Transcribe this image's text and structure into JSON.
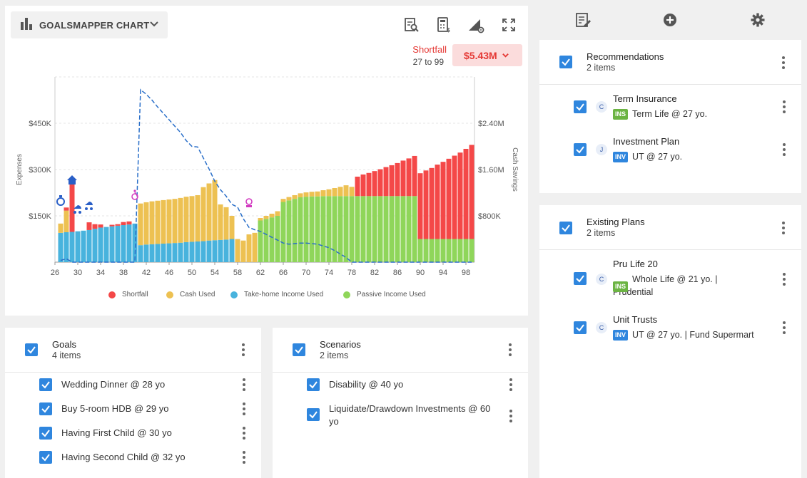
{
  "chart_panel": {
    "dropdown_label": "GOALSMAPPER CHART",
    "shortfall_label": "Shortfall",
    "shortfall_age": "27 to 99",
    "shortfall_value": "$5.43M"
  },
  "colors": {
    "shortfall": "#f44848",
    "cash": "#edc152",
    "takehome": "#48b3dd",
    "passive": "#8fd65a",
    "savings_line": "#2a6fc9",
    "accent": "#2f86de"
  },
  "chart_data": {
    "type": "bar",
    "stacked": true,
    "x_ticks": [
      "26",
      "30",
      "34",
      "38",
      "42",
      "46",
      "50",
      "54",
      "58",
      "62",
      "66",
      "70",
      "74",
      "78",
      "82",
      "86",
      "90",
      "94",
      "98"
    ],
    "ages": [
      27,
      28,
      29,
      30,
      31,
      32,
      33,
      34,
      35,
      36,
      37,
      38,
      39,
      40,
      41,
      42,
      43,
      44,
      45,
      46,
      47,
      48,
      49,
      50,
      51,
      52,
      53,
      54,
      55,
      56,
      57,
      58,
      59,
      60,
      61,
      62,
      63,
      64,
      65,
      66,
      67,
      68,
      69,
      70,
      71,
      72,
      73,
      74,
      75,
      76,
      77,
      78,
      79,
      80,
      81,
      82,
      83,
      84,
      85,
      86,
      87,
      88,
      89,
      90,
      91,
      92,
      93,
      94,
      95,
      96,
      97,
      98,
      99
    ],
    "y_left_label": "Expenses",
    "y_left_ticks": [
      "$150K",
      "$300K",
      "$450K"
    ],
    "y_right_label": "Cash Savings",
    "y_right_ticks": [
      "$800K",
      "$1.60M",
      "$2.40M"
    ],
    "y_left_range": [
      0,
      600000
    ],
    "y_right_range": [
      0,
      3200000
    ],
    "grid": true,
    "series": [
      {
        "name": "Take-home Income Used",
        "values": [
          95000,
          97000,
          98000,
          100000,
          102000,
          104000,
          108000,
          112000,
          114000,
          116000,
          118000,
          120000,
          122000,
          125000,
          55000,
          57000,
          58000,
          59000,
          60000,
          61000,
          62000,
          63000,
          65000,
          66000,
          67000,
          68000,
          70000,
          71000,
          72000,
          73000,
          75000,
          0,
          0,
          0,
          0,
          0,
          0,
          0,
          0,
          0,
          0,
          0,
          0,
          0,
          0,
          0,
          0,
          0,
          0,
          0,
          0,
          0,
          0,
          0,
          0,
          0,
          0,
          0,
          0,
          0,
          0,
          0,
          0,
          0,
          0,
          0,
          0,
          0,
          0,
          0,
          0,
          0,
          0
        ]
      },
      {
        "name": "Passive Income Used",
        "values": [
          0,
          0,
          0,
          0,
          0,
          0,
          0,
          0,
          0,
          0,
          0,
          0,
          0,
          0,
          0,
          0,
          0,
          0,
          0,
          0,
          0,
          0,
          0,
          0,
          0,
          0,
          0,
          0,
          0,
          0,
          0,
          0,
          0,
          0,
          0,
          135000,
          140000,
          145000,
          150000,
          195000,
          200000,
          205000,
          210000,
          212000,
          213000,
          213000,
          214000,
          214000,
          214000,
          214000,
          214000,
          214000,
          214000,
          214000,
          214000,
          214000,
          214000,
          214000,
          214000,
          214000,
          214000,
          214000,
          214000,
          75000,
          75000,
          75000,
          75000,
          75000,
          75000,
          75000,
          75000,
          75000,
          75000
        ]
      },
      {
        "name": "Cash Used",
        "values": [
          30000,
          70000,
          0,
          0,
          0,
          0,
          0,
          0,
          0,
          0,
          0,
          0,
          0,
          0,
          135000,
          137000,
          139000,
          140000,
          141000,
          142000,
          143000,
          145000,
          147000,
          148000,
          150000,
          175000,
          185000,
          195000,
          115000,
          105000,
          75000,
          75000,
          70000,
          90000,
          95000,
          8000,
          10000,
          12000,
          15000,
          10000,
          11000,
          12000,
          13000,
          14000,
          15000,
          16000,
          19000,
          22000,
          26000,
          30000,
          35000,
          30000,
          0,
          0,
          0,
          0,
          0,
          0,
          0,
          0,
          0,
          0,
          0,
          0,
          0,
          0,
          0,
          0,
          0,
          0,
          0,
          0,
          0
        ]
      },
      {
        "name": "Shortfall",
        "values": [
          0,
          10000,
          155000,
          0,
          0,
          25000,
          15000,
          10000,
          0,
          5000,
          5000,
          10000,
          10000,
          0,
          0,
          0,
          0,
          0,
          0,
          0,
          0,
          0,
          0,
          0,
          0,
          0,
          0,
          0,
          0,
          0,
          0,
          0,
          0,
          0,
          0,
          0,
          0,
          0,
          0,
          0,
          0,
          0,
          0,
          0,
          0,
          0,
          0,
          0,
          0,
          0,
          0,
          0,
          63000,
          70000,
          75000,
          81000,
          87000,
          94000,
          100000,
          107000,
          115000,
          122000,
          130000,
          213000,
          222000,
          230000,
          241000,
          250000,
          260000,
          270000,
          280000,
          292000,
          305000
        ]
      },
      {
        "name": "Cash Savings",
        "axis": "right",
        "values": [
          30000,
          60000,
          0,
          0,
          0,
          0,
          0,
          0,
          0,
          0,
          0,
          0,
          0,
          0,
          2980000,
          2900000,
          2800000,
          2680000,
          2570000,
          2460000,
          2350000,
          2240000,
          2100000,
          2000000,
          1990000,
          1800000,
          1610000,
          1400000,
          1250000,
          1140000,
          1000000,
          950000,
          750000,
          600000,
          560000,
          530000,
          480000,
          430000,
          380000,
          330000,
          310000,
          320000,
          330000,
          330000,
          320000,
          310000,
          280000,
          250000,
          200000,
          140000,
          80000,
          0,
          0,
          0,
          0,
          0,
          0,
          0,
          0,
          0,
          0,
          0,
          0,
          0,
          0,
          0,
          0,
          0,
          0,
          0,
          0,
          0,
          0
        ]
      }
    ],
    "milestone_icons": [
      {
        "name": "ring-icon",
        "age": 27
      },
      {
        "name": "house-icon",
        "age": 29
      },
      {
        "name": "stroller-icon",
        "age": 30
      },
      {
        "name": "stroller-icon",
        "age": 32
      },
      {
        "name": "wheelchair-icon",
        "age": 40
      },
      {
        "name": "pig-icon",
        "age": 60
      }
    ],
    "legend": [
      "Shortfall",
      "Cash Used",
      "Take-home Income Used",
      "Passive Income Used"
    ],
    "legend_position": "bottom"
  },
  "goals": {
    "title": "Goals",
    "count": "4 items",
    "items": [
      "Wedding Dinner @ 28 yo",
      "Buy 5-room HDB @ 29 yo",
      "Having First Child @ 30 yo",
      "Having Second Child @ 32 yo"
    ]
  },
  "scenarios": {
    "title": "Scenarios",
    "count": "2 items",
    "items": [
      "Disability @ 40 yo",
      "Liquidate/Drawdown Investments @ 60 yo"
    ]
  },
  "recommendations": {
    "title": "Recommendations",
    "count": "2 items",
    "items": [
      {
        "title": "Term Insurance",
        "avatar": "C",
        "tag": "INS",
        "detail": "Term Life @ 27 yo."
      },
      {
        "title": "Investment Plan",
        "avatar": "J",
        "tag": "INV",
        "detail": "UT @ 27 yo."
      }
    ]
  },
  "existing": {
    "title": "Existing Plans",
    "count": "2 items",
    "items": [
      {
        "title": "Pru Life 20",
        "avatar": "C",
        "tag": "INS",
        "detail_line1": "Whole Life @ 21 yo. |",
        "detail_line2": "Prudential"
      },
      {
        "title": "Unit Trusts",
        "avatar": "C",
        "tag": "INV",
        "detail_line1": "UT @ 27 yo. | Fund Supermart"
      }
    ]
  }
}
